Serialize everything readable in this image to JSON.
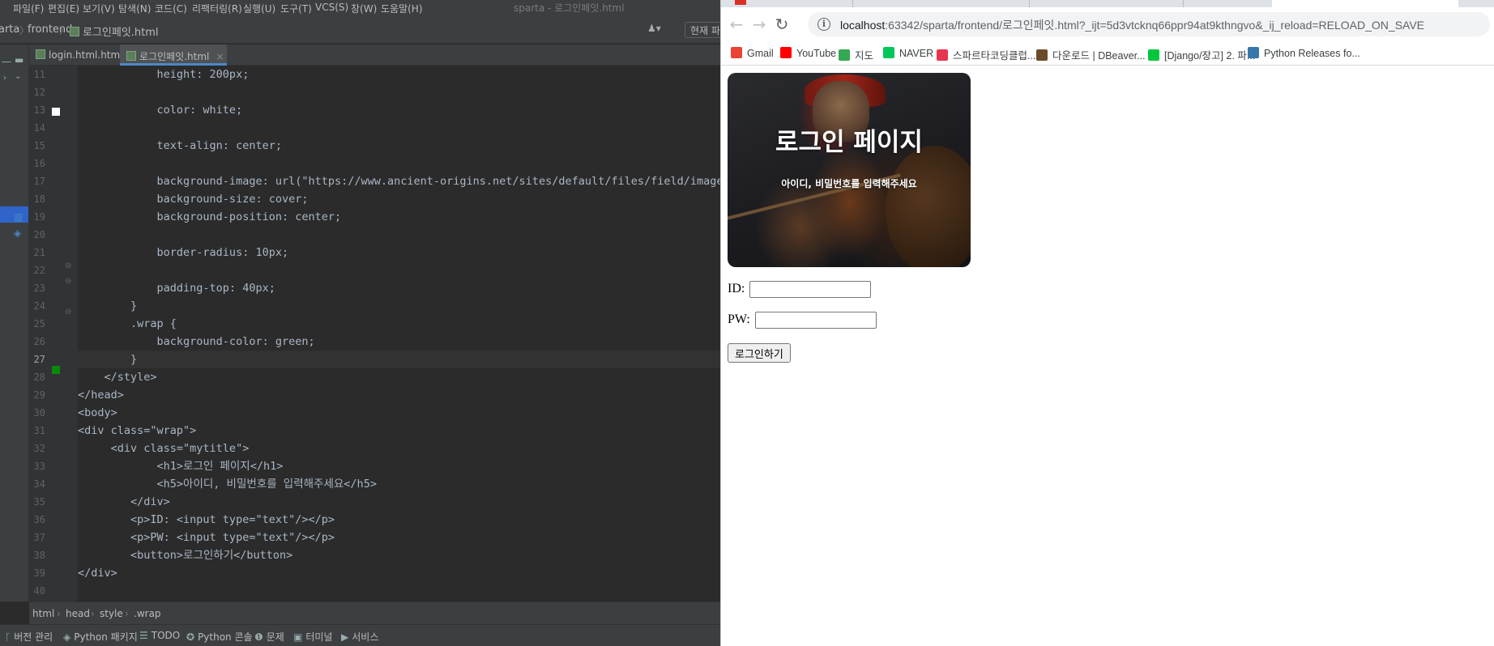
{
  "ide": {
    "menu": [
      "파일(F)",
      "편집(E)",
      "보기(V)",
      "탐색(N)",
      "코드(C)",
      "리팩터링(R)",
      "실행(U)",
      "도구(T)",
      "VCS(S)",
      "창(W)",
      "도움말(H)"
    ],
    "window_title": "sparta - 로그인페잇.html",
    "breadcrumb_top": [
      "arta",
      "frontend",
      "로그인페잇.html"
    ],
    "current_file_button": "현재 파",
    "tabs": [
      {
        "label": "login.html.html",
        "active": false
      },
      {
        "label": "로그인페잇.html",
        "active": true
      }
    ],
    "code": [
      {
        "n": "11",
        "text": "            height: 200px;"
      },
      {
        "n": "12",
        "text": ""
      },
      {
        "n": "13",
        "text": "            color: white;"
      },
      {
        "n": "14",
        "text": ""
      },
      {
        "n": "15",
        "text": "            text-align: center;"
      },
      {
        "n": "16",
        "text": ""
      },
      {
        "n": "17",
        "text": "            background-image: url(\"https://www.ancient-origins.net/sites/default/files/field/image/A"
      },
      {
        "n": "18",
        "text": "            background-size: cover;"
      },
      {
        "n": "19",
        "text": "            background-position: center;"
      },
      {
        "n": "20",
        "text": ""
      },
      {
        "n": "21",
        "text": "            border-radius: 10px;"
      },
      {
        "n": "22",
        "text": ""
      },
      {
        "n": "23",
        "text": "            padding-top: 40px;"
      },
      {
        "n": "24",
        "text": "        }"
      },
      {
        "n": "25",
        "text": "        .wrap {"
      },
      {
        "n": "26",
        "text": "            background-color: green;"
      },
      {
        "n": "27",
        "text": "        }"
      },
      {
        "n": "28",
        "text": "    </style>"
      },
      {
        "n": "29",
        "text": "</head>"
      },
      {
        "n": "30",
        "text": "<body>"
      },
      {
        "n": "31",
        "text": "<div class=\"wrap\">"
      },
      {
        "n": "32",
        "text": "     <div class=\"mytitle\">"
      },
      {
        "n": "33",
        "text": "            <h1>로그인 페이지</h1>"
      },
      {
        "n": "34",
        "text": "            <h5>아이디, 비밀번호를 입력해주세요</h5>"
      },
      {
        "n": "35",
        "text": "        </div>"
      },
      {
        "n": "36",
        "text": "        <p>ID: <input type=\"text\"/></p>"
      },
      {
        "n": "37",
        "text": "        <p>PW: <input type=\"text\"/></p>"
      },
      {
        "n": "38",
        "text": "        <button>로그인하기</button>"
      },
      {
        "n": "39",
        "text": "</div>"
      },
      {
        "n": "40",
        "text": ""
      }
    ],
    "current_line": "27",
    "breadcrumb_bottom": [
      "html",
      "head",
      "style",
      ".wrap"
    ],
    "bottom_tools": [
      "버전 관리",
      "Python 패키지",
      "TODO",
      "Python 콘솔",
      "문제",
      "터미널",
      "서비스"
    ]
  },
  "browser": {
    "url_host": "localhost",
    "url_rest": ":63342/sparta/frontend/로그인페잇.html?_ijt=5d3vtcknq66ppr94at9kthngvo&_ij_reload=RELOAD_ON_SAVE",
    "bookmarks": [
      {
        "label": "Gmail",
        "color": "#ea4335"
      },
      {
        "label": "YouTube",
        "color": "#ff0000"
      },
      {
        "label": "지도",
        "color": "#34a853"
      },
      {
        "label": "NAVER",
        "color": "#03c75a"
      },
      {
        "label": "스파르타코딩클럽...",
        "color": "#e8344e"
      },
      {
        "label": "다운로드 | DBeaver...",
        "color": "#6b4c2a"
      },
      {
        "label": "[Django/장고] 2. 파...",
        "color": "#00c73c"
      },
      {
        "label": "Python Releases fo...",
        "color": "#3776ab"
      }
    ],
    "page": {
      "h1": "로그인 페이지",
      "h5": "아이디, 비밀번호를 입력해주세요",
      "id_label": "ID:",
      "pw_label": "PW:",
      "button": "로그인하기"
    }
  }
}
